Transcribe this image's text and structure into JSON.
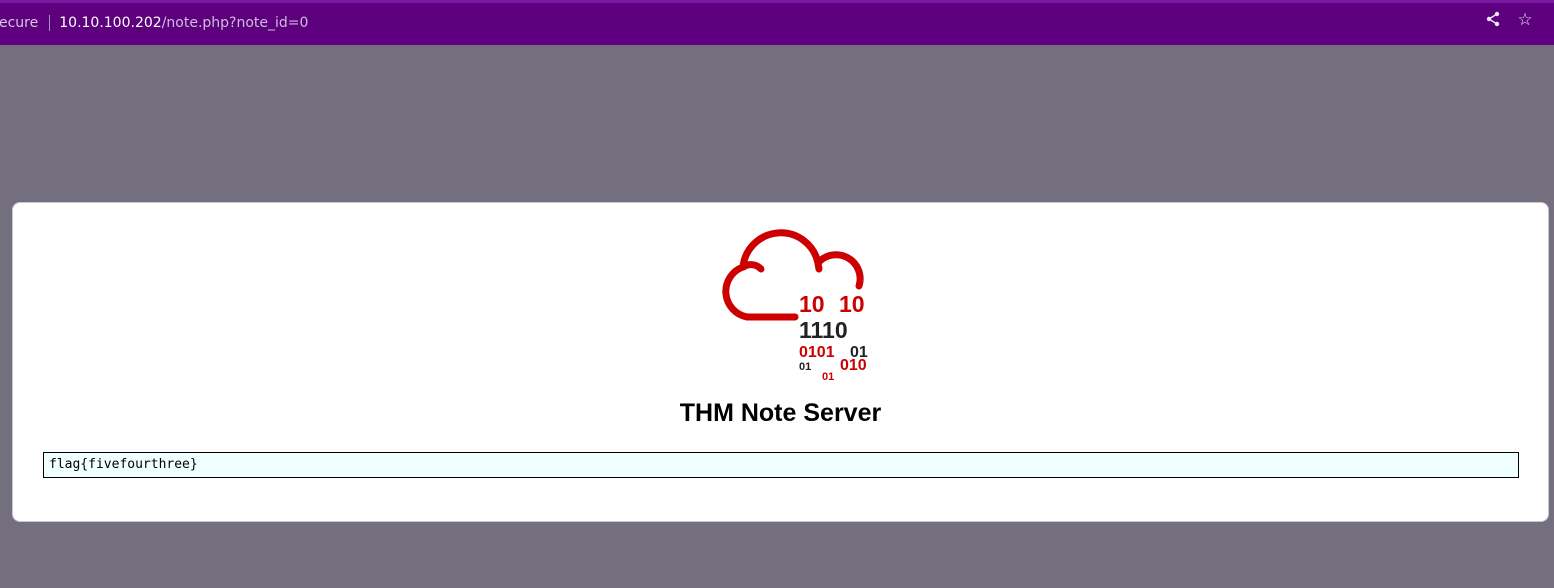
{
  "browser": {
    "security_label": "ecure",
    "url_host": "10.10.100.202",
    "url_path": "/note.php?note_id=0",
    "share_icon": "share-icon",
    "star_icon": "star-icon"
  },
  "page": {
    "logo": {
      "row1_left": "10",
      "row1_right": "10",
      "row2": "1110",
      "row3_left": "0101",
      "row3_right": "01",
      "row4_left": "01",
      "row4_right": "010",
      "row5": "01",
      "accent_color": "#cc0000",
      "dark_color": "#222222"
    },
    "title": "THM Note Server",
    "note_text": "flag{fivefourthree}"
  }
}
